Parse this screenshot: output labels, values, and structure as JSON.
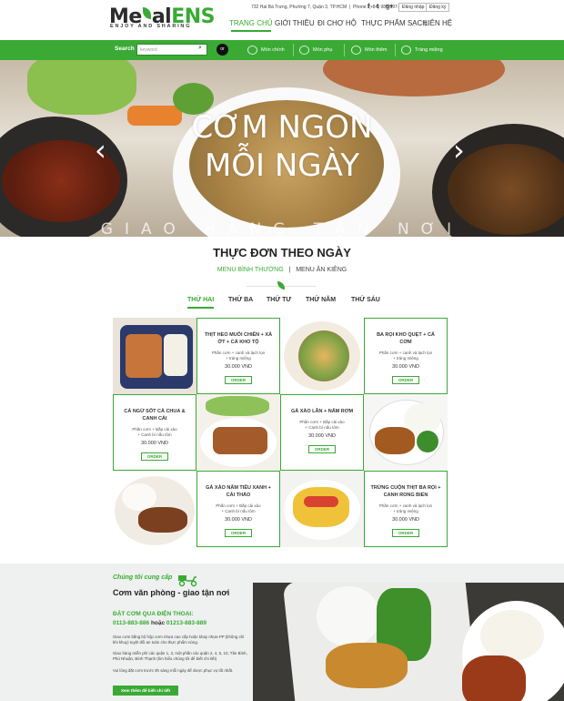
{
  "brand": {
    "logo_a": "Me",
    "logo_b": "al",
    "logo_c": "ENS",
    "tagline": "ENJOY AND SHARING"
  },
  "topbar": {
    "address": "732 Hai Bà Trưng, Phường 7, Quận 3, TP.HCM",
    "phone": "Phone: (+84) 987-997-945",
    "login": "Đăng nhập",
    "register": "Đăng ký",
    "social": [
      "f",
      "t",
      "g+"
    ]
  },
  "nav": {
    "items": [
      "TRANG CHỦ",
      "GIỚI THIỆU",
      "ĐI CHỢ HỘ",
      "THỰC PHẨM SẠCH",
      "LIÊN HỆ"
    ],
    "active": 0
  },
  "search": {
    "label": "Search",
    "placeholder": "keyword",
    "or": "or"
  },
  "categories": [
    "Món chính",
    "Món phụ",
    "Món thêm",
    "Tráng miệng"
  ],
  "hero": {
    "line1": "CƠM NGON",
    "line2": "MỖI NGÀY",
    "subtitle": "GIAO HÀNG TẬN NƠI",
    "prev": "‹",
    "next": "›"
  },
  "menu": {
    "title": "THỰC ĐƠN THEO NGÀY",
    "tab_regular": "MENU BÌNH THƯỜNG",
    "separator": "|",
    "tab_diet": "MENU ĂN KIÊNG",
    "days": [
      "THỨ HAI",
      "THỨ BA",
      "THỨ TƯ",
      "THỨ NĂM",
      "THỨ SÁU"
    ],
    "active_day": 0
  },
  "dishes": [
    {
      "name": "THỊT HEO MUỐI CHIÊN + XÀ ỚT + CÁ KHO TỘ",
      "desc1": "Phần cơm + canh và lạch lọn",
      "desc2": "+ tráng miệng",
      "price": "30.000 VND",
      "order": "ORDER"
    },
    {
      "name": "BA RỌI KHO QUẸT + CÁ CƠM",
      "desc1": "Phần cơm + canh và lạch lọn",
      "desc2": "+ tráng miệng",
      "price": "30.000 VND",
      "order": "ORDER"
    },
    {
      "name": "CÁ NGỪ SỐT CÀ CHUA & CANH CẢI",
      "desc1": "Phần cơm + Bắp cải xào",
      "desc2": "+ Canh bí nấu tôm",
      "price": "30.000 VND",
      "order": "ORDER"
    },
    {
      "name": "GÀ XÀO LĂN + NẤM RƠM",
      "desc1": "Phần cơm + Bắp cải xào",
      "desc2": "+ Canh bí nấu tôm",
      "price": "30.000 VND",
      "order": "ORDER"
    },
    {
      "name": "GÀ XÀO NẤM TIÊU XANH + CẢI THẢO",
      "desc1": "Phần cơm + Bắp cải xào",
      "desc2": "+ Canh bí nấu tôm",
      "price": "30.000 VND",
      "order": "ORDER"
    },
    {
      "name": "TRỨNG CUỘN THỊT BA RỌI + CANH RONG BIỂN",
      "desc1": "Phần cơm + canh và lạch lọn",
      "desc2": "+ tráng miệng",
      "price": "30.000 VND",
      "order": "ORDER"
    }
  ],
  "promo": {
    "provide": "Chúng tôi cung cấp",
    "headline": "Cơm văn phòng - giao tận nơi",
    "order_title": "ĐẶT CƠM QUA ĐIỆN THOẠI:",
    "phone1": "0113-883-886",
    "or_word": "hoặc",
    "phone2": "01213-883-889",
    "p1": "Giao cơm bằng bộ hộp cơm nhựa cao cấp hoặc khay nhựa PP (không chì khi khuy) tuyệt đối an toàn cho thực phẩm nóng.",
    "p2": "Giao hàng miễn phí các quận 1, 3, một phần các quận 2, 4, 5, 10, Tân Bình, Phú Nhuận, Bình Thạnh (tìm hiểu chúng tôi để biết chi tiết)",
    "p3": "Vui lòng đặt cơm trước 9h sáng mỗi ngày để được phục vụ tốt nhất.",
    "more": "Xem thêm để biết chi tiết"
  },
  "colors": {
    "brand_green": "#3aaa35"
  }
}
